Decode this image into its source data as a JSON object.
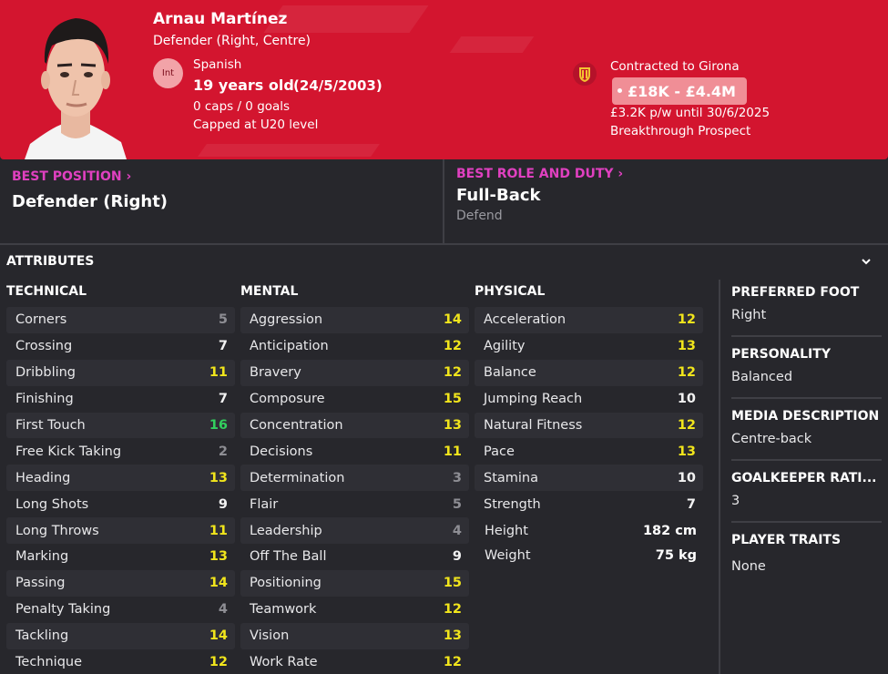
{
  "player": {
    "name": "Arnau Martínez",
    "positions": "Defender (Right, Centre)",
    "int_badge": "Int",
    "nationality": "Spanish",
    "age": "19 years old",
    "dob": "(24/5/2003)",
    "caps_goals": "0 caps / 0 goals",
    "capped_level": "Capped at U20 level"
  },
  "contract": {
    "club_text": "Contracted to Girona",
    "value_range": "£18K - £4.4M",
    "wage_text": "£3.2K p/w until 30/6/2025",
    "status": "Breakthrough Prospect"
  },
  "best": {
    "position_label": "BEST POSITION",
    "position_value": "Defender (Right)",
    "role_label": "BEST ROLE AND DUTY",
    "role_value": "Full-Back",
    "duty_value": "Defend"
  },
  "attributes": {
    "title": "ATTRIBUTES",
    "technical": {
      "title": "TECHNICAL",
      "items": [
        {
          "name": "Corners",
          "value": "5"
        },
        {
          "name": "Crossing",
          "value": "7"
        },
        {
          "name": "Dribbling",
          "value": "11"
        },
        {
          "name": "Finishing",
          "value": "7"
        },
        {
          "name": "First Touch",
          "value": "16"
        },
        {
          "name": "Free Kick Taking",
          "value": "2"
        },
        {
          "name": "Heading",
          "value": "13"
        },
        {
          "name": "Long Shots",
          "value": "9"
        },
        {
          "name": "Long Throws",
          "value": "11"
        },
        {
          "name": "Marking",
          "value": "13"
        },
        {
          "name": "Passing",
          "value": "14"
        },
        {
          "name": "Penalty Taking",
          "value": "4"
        },
        {
          "name": "Tackling",
          "value": "14"
        },
        {
          "name": "Technique",
          "value": "12"
        }
      ]
    },
    "mental": {
      "title": "MENTAL",
      "items": [
        {
          "name": "Aggression",
          "value": "14"
        },
        {
          "name": "Anticipation",
          "value": "12"
        },
        {
          "name": "Bravery",
          "value": "12"
        },
        {
          "name": "Composure",
          "value": "15"
        },
        {
          "name": "Concentration",
          "value": "13"
        },
        {
          "name": "Decisions",
          "value": "11"
        },
        {
          "name": "Determination",
          "value": "3"
        },
        {
          "name": "Flair",
          "value": "5"
        },
        {
          "name": "Leadership",
          "value": "4"
        },
        {
          "name": "Off The Ball",
          "value": "9"
        },
        {
          "name": "Positioning",
          "value": "15"
        },
        {
          "name": "Teamwork",
          "value": "12"
        },
        {
          "name": "Vision",
          "value": "13"
        },
        {
          "name": "Work Rate",
          "value": "12"
        }
      ]
    },
    "physical": {
      "title": "PHYSICAL",
      "items": [
        {
          "name": "Acceleration",
          "value": "12"
        },
        {
          "name": "Agility",
          "value": "13"
        },
        {
          "name": "Balance",
          "value": "12"
        },
        {
          "name": "Jumping Reach",
          "value": "10"
        },
        {
          "name": "Natural Fitness",
          "value": "12"
        },
        {
          "name": "Pace",
          "value": "13"
        },
        {
          "name": "Stamina",
          "value": "10"
        },
        {
          "name": "Strength",
          "value": "7"
        }
      ],
      "height_label": "Height",
      "height_value": "182 cm",
      "weight_label": "Weight",
      "weight_value": "75 kg"
    }
  },
  "side": {
    "foot_label": "PREFERRED FOOT",
    "foot_value": "Right",
    "personality_label": "PERSONALITY",
    "personality_value": "Balanced",
    "media_label": "MEDIA DESCRIPTION",
    "media_value": "Centre-back",
    "gk_label": "GOALKEEPER RATI...",
    "gk_value": "3",
    "traits_label": "PLAYER TRAITS",
    "traits_value": "None"
  },
  "colors": {
    "header_bg": "#d3152f",
    "accent_magenta": "#e040c0",
    "attr_yellow": "#f1e51c",
    "attr_green": "#32d15e",
    "attr_grey": "#8e8e94"
  }
}
